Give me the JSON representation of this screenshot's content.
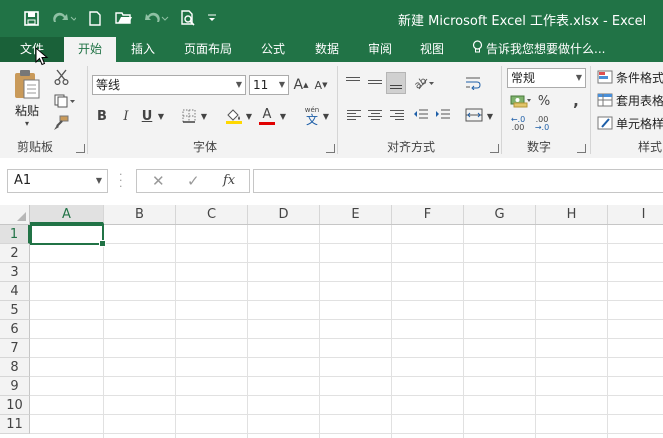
{
  "window": {
    "title": "新建 Microsoft Excel 工作表.xlsx - Excel"
  },
  "quick_access": {
    "icons": [
      "save-icon",
      "redo-icon",
      "new-file-icon",
      "open-folder-icon",
      "undo-icon",
      "print-preview-icon",
      "customize-qat-icon"
    ]
  },
  "tabs": [
    {
      "label": "文件"
    },
    {
      "label": "开始"
    },
    {
      "label": "插入"
    },
    {
      "label": "页面布局"
    },
    {
      "label": "公式"
    },
    {
      "label": "数据"
    },
    {
      "label": "审阅"
    },
    {
      "label": "视图"
    }
  ],
  "tell_me": {
    "placeholder": "告诉我您想要做什么..."
  },
  "ribbon": {
    "clipboard": {
      "label": "剪贴板",
      "paste_label": "粘贴"
    },
    "font": {
      "label": "字体",
      "font_name": "等线",
      "font_size": "11",
      "bold": "B",
      "italic": "I",
      "underline": "U",
      "grow": "A",
      "shrink": "A",
      "font_color_letter": "A",
      "phonetic_label": "wén",
      "phonetic_char": "文"
    },
    "alignment": {
      "label": "对齐方式"
    },
    "number": {
      "label": "数字",
      "format": "常规",
      "percent": "%",
      "comma": ",",
      "inc_decimal": ".00",
      "dec_decimal": ".0"
    },
    "styles": {
      "label": "样式",
      "conditional": "条件格式",
      "table_format": "套用表格",
      "cell_styles": "单元格样"
    },
    "colors": {
      "accent": "#217346",
      "font_color_bar": "#e00000",
      "fill_color_bar": "#ffd800"
    }
  },
  "formula_bar": {
    "name_box": "A1",
    "cancel": "✕",
    "enter": "✓",
    "fx": "fx",
    "value": ""
  },
  "sheet": {
    "columns": [
      "A",
      "B",
      "C",
      "D",
      "E",
      "F",
      "G",
      "H",
      "I"
    ],
    "rows": [
      "1",
      "2",
      "3",
      "4",
      "5",
      "6",
      "7",
      "8",
      "9",
      "10",
      "11"
    ],
    "active_cell": "A1"
  }
}
